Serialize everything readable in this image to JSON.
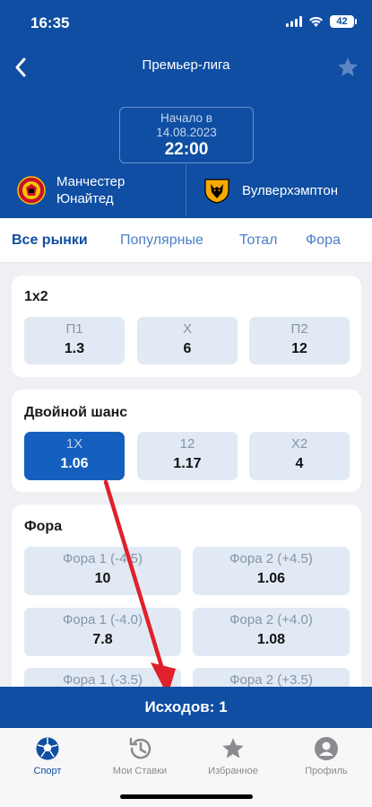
{
  "status_bar": {
    "time": "16:35",
    "battery": "42"
  },
  "header": {
    "title": "Премьер-лига",
    "start_label": "Начало в",
    "start_date": "14.08.2023",
    "start_time": "22:00",
    "team1": "Манчестер Юнайтед",
    "team2": "Вулверхэмптон"
  },
  "tabs": [
    "Все рынки",
    "Популярные",
    "Тотал",
    "Фора"
  ],
  "markets": {
    "one_x_two": {
      "title": "1x2",
      "odds": [
        {
          "label": "П1",
          "value": "1.3"
        },
        {
          "label": "Х",
          "value": "6"
        },
        {
          "label": "П2",
          "value": "12"
        }
      ]
    },
    "double_chance": {
      "title": "Двойной шанс",
      "odds": [
        {
          "label": "1X",
          "value": "1.06",
          "selected": true
        },
        {
          "label": "12",
          "value": "1.17"
        },
        {
          "label": "X2",
          "value": "4"
        }
      ]
    },
    "handicap": {
      "title": "Фора",
      "odds": [
        {
          "label": "Фора 1 (-4.5)",
          "value": "10"
        },
        {
          "label": "Фора 2 (+4.5)",
          "value": "1.06"
        },
        {
          "label": "Фора 1 (-4.0)",
          "value": "7.8"
        },
        {
          "label": "Фора 2 (+4.0)",
          "value": "1.08"
        },
        {
          "label": "Фора 1 (-3.5)",
          "value": ""
        },
        {
          "label": "Фора 2 (+3.5)",
          "value": ""
        }
      ]
    }
  },
  "outcome_bar": "Исходов: 1",
  "bottom_nav": [
    {
      "label": "Спорт",
      "icon": "soccer-ball-icon",
      "active": true
    },
    {
      "label": "Мои Ставки",
      "icon": "history-icon"
    },
    {
      "label": "Избранное",
      "icon": "star-icon"
    },
    {
      "label": "Профиль",
      "icon": "profile-icon"
    }
  ],
  "colors": {
    "primary": "#0f4ea2",
    "selected": "#1560be",
    "odd_bg": "#e1e9f4",
    "arrow": "#e0202a"
  }
}
